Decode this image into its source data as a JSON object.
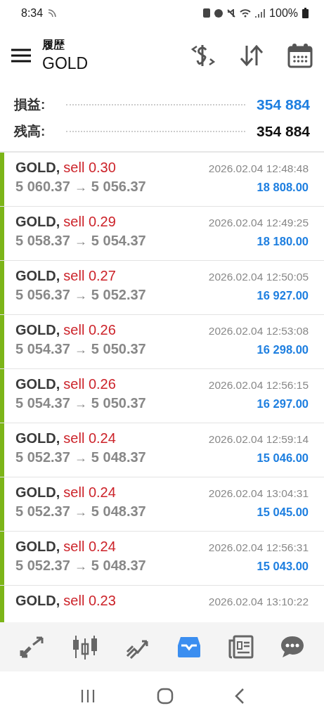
{
  "status_bar": {
    "time": "8:34",
    "battery": "100%"
  },
  "header": {
    "title": "履歴",
    "symbol": "GOLD"
  },
  "summary": [
    {
      "label": "損益:",
      "value": "354 884",
      "kind": "profit"
    },
    {
      "label": "残高:",
      "value": "354 884",
      "kind": "balance"
    }
  ],
  "deals": [
    {
      "symbol": "GOLD,",
      "side": "sell 0.30",
      "open_price": "5 060.37",
      "arrow": "→",
      "close_price": "5 056.37",
      "time": "2026.02.04 12:48:48",
      "profit": "18 808.00"
    },
    {
      "symbol": "GOLD,",
      "side": "sell 0.29",
      "open_price": "5 058.37",
      "arrow": "→",
      "close_price": "5 054.37",
      "time": "2026.02.04 12:49:25",
      "profit": "18 180.00"
    },
    {
      "symbol": "GOLD,",
      "side": "sell 0.27",
      "open_price": "5 056.37",
      "arrow": "→",
      "close_price": "5 052.37",
      "time": "2026.02.04 12:50:05",
      "profit": "16 927.00"
    },
    {
      "symbol": "GOLD,",
      "side": "sell 0.26",
      "open_price": "5 054.37",
      "arrow": "→",
      "close_price": "5 050.37",
      "time": "2026.02.04 12:53:08",
      "profit": "16 298.00"
    },
    {
      "symbol": "GOLD,",
      "side": "sell 0.26",
      "open_price": "5 054.37",
      "arrow": "→",
      "close_price": "5 050.37",
      "time": "2026.02.04 12:56:15",
      "profit": "16 297.00"
    },
    {
      "symbol": "GOLD,",
      "side": "sell 0.24",
      "open_price": "5 052.37",
      "arrow": "→",
      "close_price": "5 048.37",
      "time": "2026.02.04 12:59:14",
      "profit": "15 046.00"
    },
    {
      "symbol": "GOLD,",
      "side": "sell 0.24",
      "open_price": "5 052.37",
      "arrow": "→",
      "close_price": "5 048.37",
      "time": "2026.02.04 13:04:31",
      "profit": "15 045.00"
    },
    {
      "symbol": "GOLD,",
      "side": "sell 0.24",
      "open_price": "5 052.37",
      "arrow": "→",
      "close_price": "5 048.37",
      "time": "2026.02.04 12:56:31",
      "profit": "15 043.00"
    },
    {
      "symbol": "GOLD,",
      "side": "sell 0.23",
      "time": "2026.02.04 13:10:22"
    }
  ],
  "bottom_nav": [
    {
      "kind": "quotes",
      "selected": false
    },
    {
      "kind": "chart",
      "selected": false
    },
    {
      "kind": "trade",
      "selected": false
    },
    {
      "kind": "history",
      "selected": true
    },
    {
      "kind": "news",
      "selected": false
    },
    {
      "kind": "chat",
      "selected": false
    }
  ]
}
